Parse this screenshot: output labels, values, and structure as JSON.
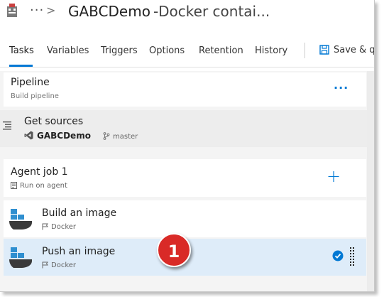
{
  "header": {
    "breadcrumb_dots": "···",
    "chevron": ">",
    "title": "GABCDemo",
    "subtitle": "-Docker contai..."
  },
  "tabs": [
    {
      "label": "Tasks",
      "active": true
    },
    {
      "label": "Variables"
    },
    {
      "label": "Triggers"
    },
    {
      "label": "Options"
    },
    {
      "label": "Retention"
    },
    {
      "label": "History"
    }
  ],
  "toolbar": {
    "save_label": "Save & q"
  },
  "pipeline": {
    "title": "Pipeline",
    "subtitle": "Build pipeline",
    "more": "···"
  },
  "get_sources": {
    "title": "Get sources",
    "repo": "GABCDemo",
    "branch": "master"
  },
  "agent_job": {
    "title": "Agent job 1",
    "subtitle": "Run on agent",
    "add": "+"
  },
  "tasks": [
    {
      "title": "Build an image",
      "subtitle": "Docker",
      "selected": false
    },
    {
      "title": "Push an image",
      "subtitle": "Docker",
      "selected": true
    }
  ],
  "callout": {
    "number": "1"
  },
  "colors": {
    "accent": "#0078d4",
    "selected_row": "#deecf9",
    "callout": "#d92a27",
    "docker_blue": "#2f8fd0"
  }
}
